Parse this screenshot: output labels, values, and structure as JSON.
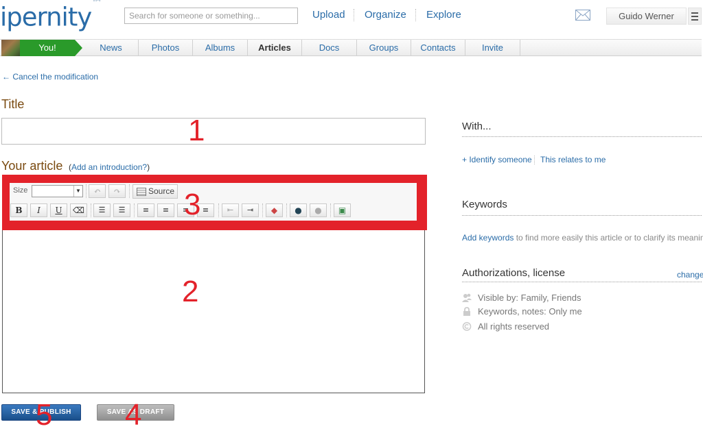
{
  "header": {
    "logo": "ipernity",
    "logo_tm": "TM",
    "search_placeholder": "Search for someone or something...",
    "nav": [
      "Upload",
      "Organize",
      "Explore"
    ],
    "user": "Guido Werner"
  },
  "tabs": {
    "you": "You!",
    "items": [
      "News",
      "Photos",
      "Albums",
      "Articles",
      "Docs",
      "Groups",
      "Contacts",
      "Invite"
    ],
    "active": "Articles"
  },
  "editor": {
    "cancel": "← Cancel the modification",
    "title_label": "Title",
    "article_label": "Your article",
    "intro_open": "(",
    "intro_link": "Add an introduction?",
    "intro_close": ")",
    "size_label": "Size",
    "source_label": "Source",
    "publish": "SAVE & PUBLISH",
    "draft": "SAVE AS DRAFT"
  },
  "annotations": [
    "1",
    "2",
    "3",
    "4",
    "5"
  ],
  "sidebar": {
    "with_heading": "With...",
    "identify": "+ Identify someone",
    "relates": "This relates to me",
    "keywords_heading": "Keywords",
    "add_keywords": "Add keywords",
    "keywords_hint": "to find more easily this article or to clarify its meaning.",
    "auth_heading": "Authorizations, license",
    "change": "change",
    "visible": "Visible by: Family, Friends",
    "notes": "Keywords, notes: Only me",
    "rights": "All rights reserved"
  },
  "colors": {
    "brand_blue": "#2a6ca8",
    "you_green": "#2a9a2a",
    "annotation_red": "#e3222a",
    "label_brown": "#7a4a10"
  }
}
